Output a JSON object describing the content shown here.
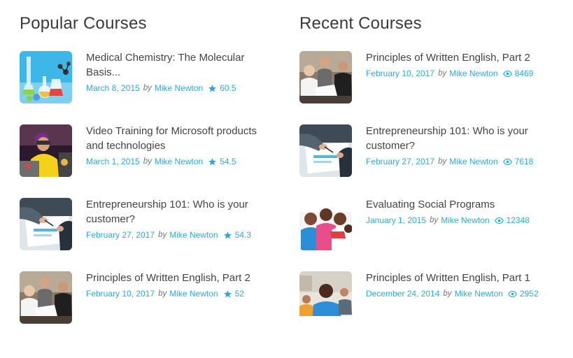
{
  "popular": {
    "title": "Popular Courses",
    "courses": [
      {
        "title": "Medical Chemistry: The Molecular Basis...",
        "date": "March 8, 2015",
        "by": "by",
        "author": "Mike Newton",
        "stat_icon": "star-icon",
        "stat": "60.5"
      },
      {
        "title": "Video Training for Microsoft products and technologies",
        "date": "March 1, 2015",
        "by": "by",
        "author": "Mike Newton",
        "stat_icon": "star-icon",
        "stat": "54.5"
      },
      {
        "title": "Entrepreneurship 101: Who is your customer?",
        "date": "February 27, 2017",
        "by": "by",
        "author": "Mike Newton",
        "stat_icon": "star-icon",
        "stat": "54.3"
      },
      {
        "title": "Principles of Written English, Part 2",
        "date": "February 10, 2017",
        "by": "by",
        "author": "Mike Newton",
        "stat_icon": "star-icon",
        "stat": "52"
      }
    ]
  },
  "recent": {
    "title": "Recent Courses",
    "courses": [
      {
        "title": "Principles of Written English, Part 2",
        "date": "February 10, 2017",
        "by": "by",
        "author": "Mike Newton",
        "stat_icon": "eye-icon",
        "stat": "8469"
      },
      {
        "title": "Entrepreneurship 101: Who is your customer?",
        "date": "February 27, 2017",
        "by": "by",
        "author": "Mike Newton",
        "stat_icon": "eye-icon",
        "stat": "7618"
      },
      {
        "title": "Evaluating Social Programs",
        "date": "January 1, 2015",
        "by": "by",
        "author": "Mike Newton",
        "stat_icon": "eye-icon",
        "stat": "12348"
      },
      {
        "title": "Principles of Written English, Part 1",
        "date": "December 24, 2014",
        "by": "by",
        "author": "Mike Newton",
        "stat_icon": "eye-icon",
        "stat": "2952"
      }
    ]
  },
  "colors": {
    "accent": "#2fa9d9",
    "title_text": "#444444",
    "heading_text": "#3a3a3a"
  }
}
